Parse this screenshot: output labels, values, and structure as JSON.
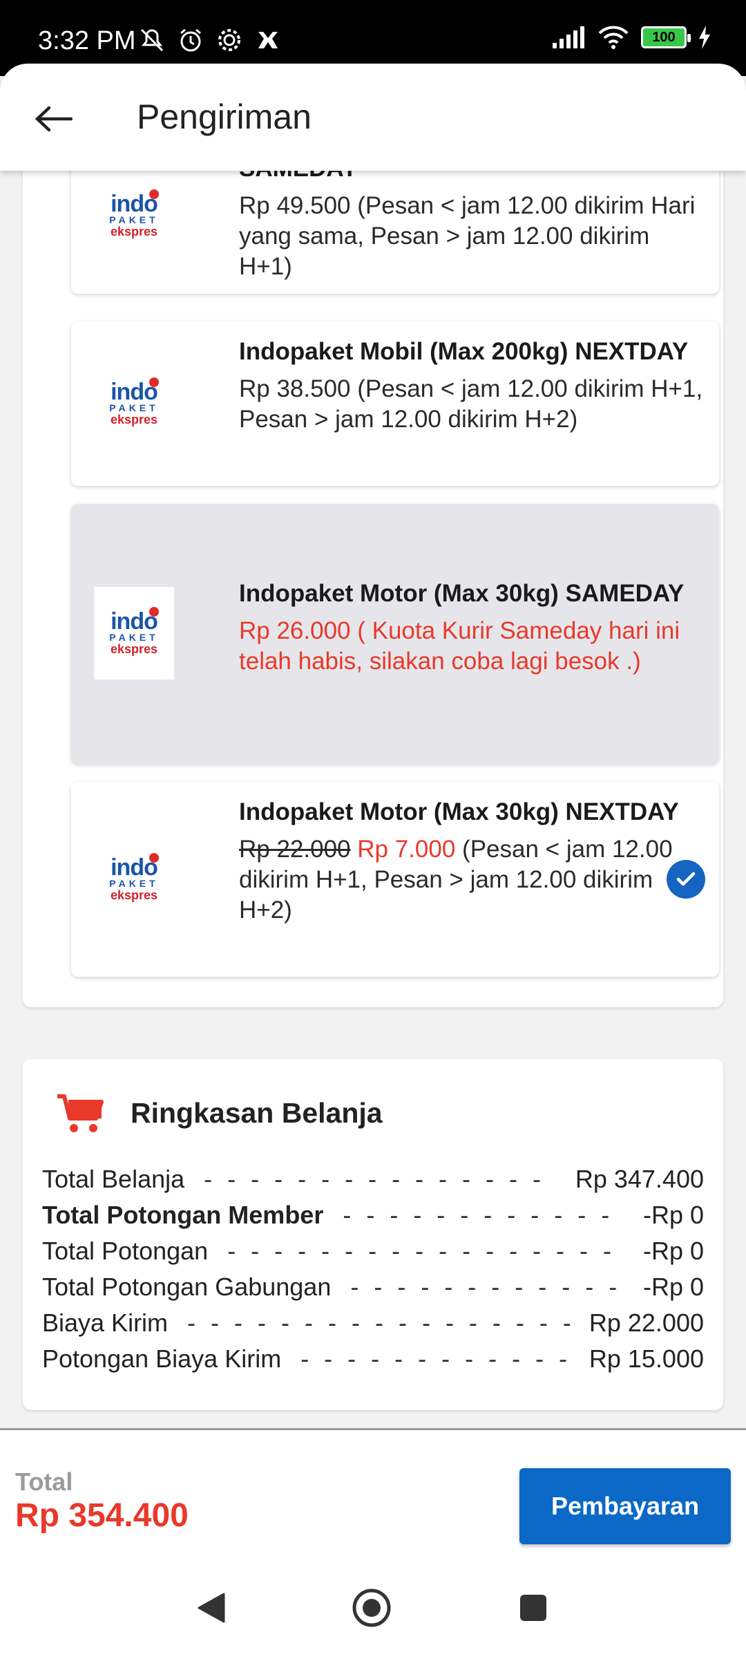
{
  "status_bar": {
    "time": "3:32 PM",
    "battery": "100",
    "icons": [
      "mute-icon",
      "alarm-icon",
      "settings-icon",
      "notification-icon",
      "signal-icon",
      "wifi-icon",
      "battery-icon",
      "charging-icon"
    ]
  },
  "header": {
    "title": "Pengiriman",
    "back_icon": "arrow-left-icon"
  },
  "shipping_options": [
    {
      "logo": {
        "indo": "indo",
        "paket": "PAKET",
        "ekspres": "ekspres"
      },
      "title": "SAMEDAY",
      "desc": "Rp 49.500 (Pesan < jam 12.00 dikirim Hari yang sama, Pesan > jam 12.00 dikirim H+1)"
    },
    {
      "logo": {
        "indo": "indo",
        "paket": "PAKET",
        "ekspres": "ekspres"
      },
      "title": "Indopaket Mobil (Max 200kg) NEXTDAY",
      "desc": "Rp 38.500 (Pesan < jam 12.00 dikirim H+1, Pesan > jam 12.00 dikirim H+2)"
    },
    {
      "logo": {
        "indo": "indo",
        "paket": "PAKET",
        "ekspres": "ekspres"
      },
      "title": "Indopaket Motor (Max 30kg) SAMEDAY",
      "desc": "Rp 26.000 ( Kuota Kurir Sameday hari ini telah habis, silakan coba lagi besok .)",
      "disabled": true
    },
    {
      "logo": {
        "indo": "indo",
        "paket": "PAKET",
        "ekspres": "ekspres"
      },
      "title": "Indopaket Motor (Max 30kg) NEXTDAY",
      "old_price": "Rp 22.000",
      "new_price": "Rp 7.000",
      "desc_rest": " (Pesan < jam 12.00 dikirim H+1, Pesan > jam 12.00 dikirim H+2)",
      "selected": true
    }
  ],
  "summary": {
    "title": "Ringkasan Belanja",
    "icon": "cart-icon",
    "rows": [
      {
        "label": "Total Belanja",
        "value": "Rp 347.400",
        "bold": false
      },
      {
        "label": "Total Potongan Member",
        "value": "-Rp 0",
        "bold": true
      },
      {
        "label": "Total Potongan",
        "value": "-Rp 0",
        "bold": false
      },
      {
        "label": "Total Potongan Gabungan",
        "value": "-Rp 0",
        "bold": false
      },
      {
        "label": "Biaya Kirim",
        "value": "Rp 22.000",
        "bold": false
      },
      {
        "label": "Potongan Biaya Kirim",
        "value": "Rp 15.000",
        "bold": false
      }
    ]
  },
  "footer": {
    "total_label": "Total",
    "total_value": "Rp 354.400",
    "pay_button": "Pembayaran"
  },
  "colors": {
    "primary_blue": "#0b68c6",
    "price_red": "#e8392b",
    "disabled_bg": "#e6e6ea"
  }
}
